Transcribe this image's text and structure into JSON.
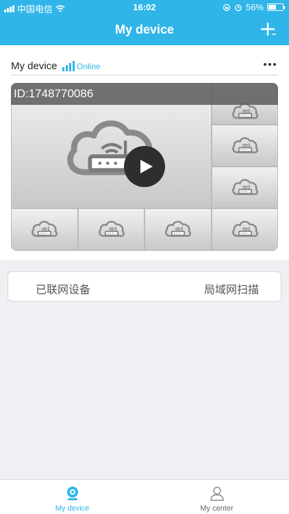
{
  "statusbar": {
    "carrier": "中国电信",
    "time": "16:02",
    "battery": "56%",
    "battery_level": 0.56
  },
  "navbar": {
    "title": "My device"
  },
  "device": {
    "name": "My device",
    "status": "Online",
    "id_label": "ID:1748770086"
  },
  "tabs": {
    "connected": "已联网设备",
    "lan_scan": "局域网扫描"
  },
  "tabbar": {
    "my_device": "My device",
    "my_center": "My center"
  },
  "colors": {
    "accent": "#2fb5e8"
  }
}
